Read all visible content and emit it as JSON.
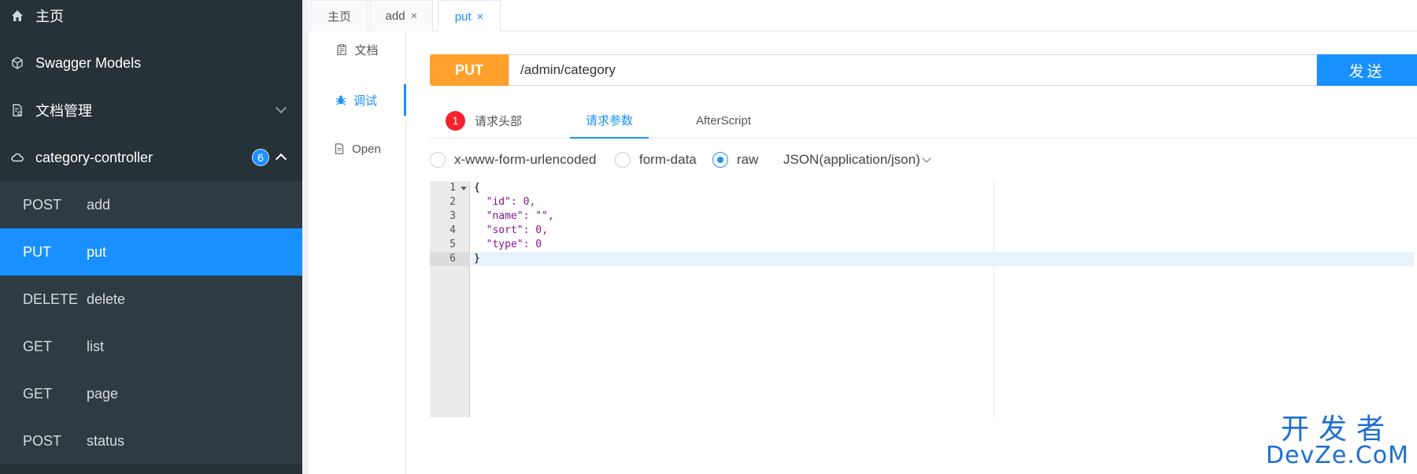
{
  "sidebar": {
    "home_label": "主页",
    "models_label": "Swagger Models",
    "docs_label": "文档管理",
    "controller_label": "category-controller",
    "controller_count": "6",
    "endpoints": [
      {
        "method": "POST",
        "name": "add"
      },
      {
        "method": "PUT",
        "name": "put"
      },
      {
        "method": "DELETE",
        "name": "delete"
      },
      {
        "method": "GET",
        "name": "list"
      },
      {
        "method": "GET",
        "name": "page"
      },
      {
        "method": "POST",
        "name": "status"
      }
    ]
  },
  "tabs": [
    {
      "label": "主页"
    },
    {
      "label": "add"
    },
    {
      "label": "put"
    }
  ],
  "tab_close_glyph": "×",
  "subnav": {
    "doc_label": "文档",
    "debug_label": "调试",
    "open_label": "Open"
  },
  "request": {
    "method": "PUT",
    "url": "/admin/category",
    "send_label": "发送"
  },
  "param_tabs": {
    "headers_count": "1",
    "headers_label": "请求头部",
    "params_label": "请求参数",
    "script_label": "AfterScript"
  },
  "body_types": {
    "urlencoded": "x-www-form-urlencoded",
    "formdata": "form-data",
    "raw": "raw",
    "content_type": "JSON(application/json)"
  },
  "editor": {
    "line_numbers": [
      "1",
      "2",
      "3",
      "4",
      "5",
      "6"
    ],
    "lines": [
      "{",
      "  \"id\": 0,",
      "  \"name\": \"\",",
      "  \"sort\": 0,",
      "  \"type\": 0",
      "}"
    ]
  },
  "watermark": {
    "cn": "开发者",
    "en": "DevZe.CoM"
  },
  "colors": {
    "sidebar_bg": "#263238",
    "accent": "#1890ff",
    "method_put": "#ffa12b",
    "error_badge": "#f5222d"
  }
}
